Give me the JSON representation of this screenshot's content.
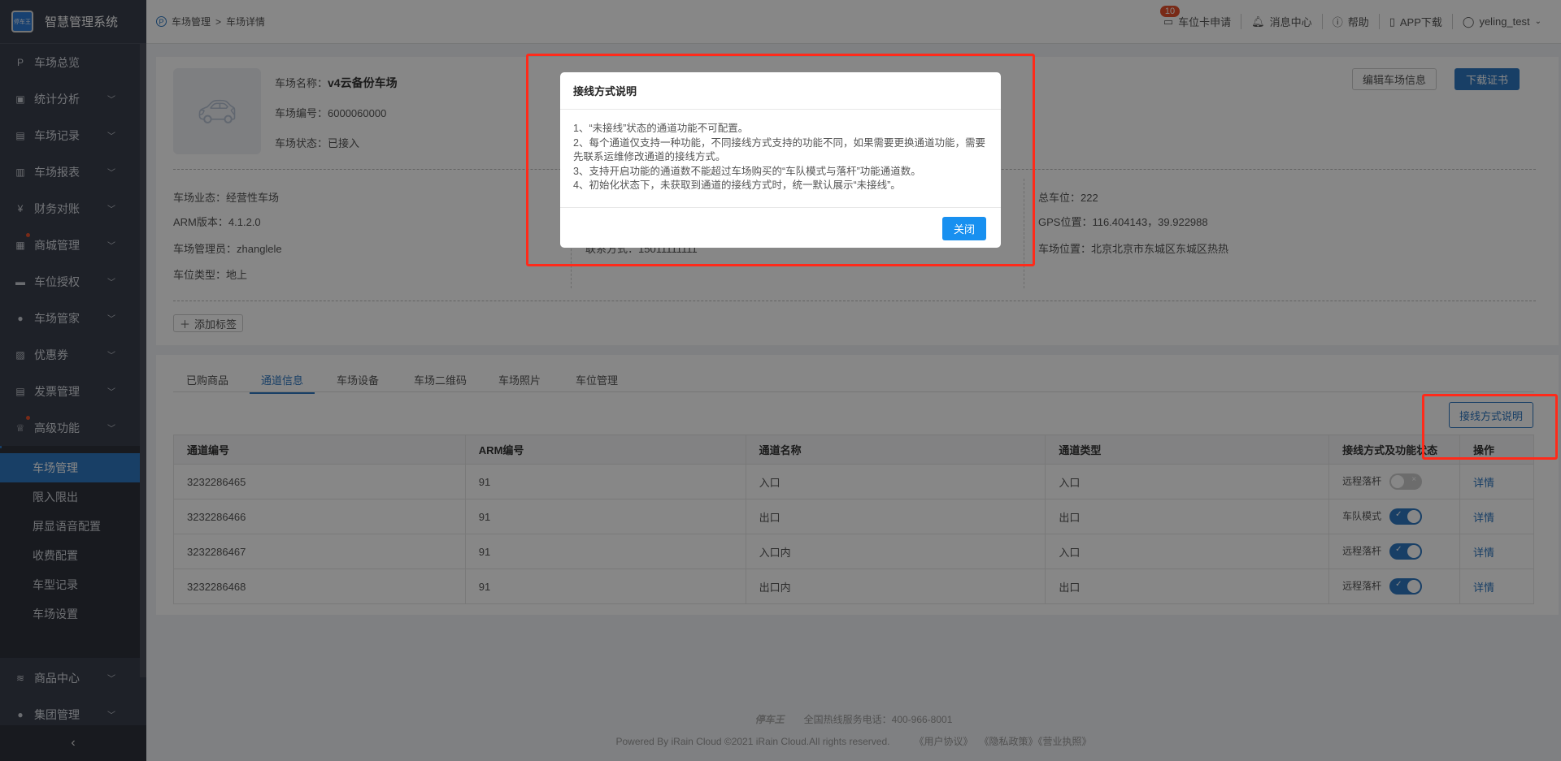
{
  "app": {
    "title": "智慧管理系统",
    "logo_text": "停车王"
  },
  "sidebar": {
    "items": [
      {
        "label": "车场总览",
        "icon": "parking-car-icon"
      },
      {
        "label": "统计分析",
        "icon": "monitor-icon"
      },
      {
        "label": "车场记录",
        "icon": "file-icon"
      },
      {
        "label": "车场报表",
        "icon": "report-icon"
      },
      {
        "label": "财务对账",
        "icon": "yen-icon"
      },
      {
        "label": "商城管理",
        "icon": "shop-icon"
      },
      {
        "label": "车位授权",
        "icon": "car-icon"
      },
      {
        "label": "车场管家",
        "icon": "user-icon"
      },
      {
        "label": "优惠券",
        "icon": "coupon-icon"
      },
      {
        "label": "发票管理",
        "icon": "invoice-icon"
      },
      {
        "label": "高级功能",
        "icon": "crown-icon"
      },
      {
        "label": "车场管理",
        "icon": "parking-icon"
      }
    ],
    "sub_items": [
      "车场管理",
      "限入限出",
      "屏显语音配置",
      "收费配置",
      "车型记录",
      "车场设置"
    ],
    "bottom_items": [
      {
        "label": "商品中心",
        "icon": "layers-icon"
      },
      {
        "label": "集团管理",
        "icon": "group-icon"
      }
    ],
    "collapse": "‹"
  },
  "header": {
    "breadcrumb": [
      "车场管理",
      "车场详情"
    ],
    "separator": ">",
    "right": {
      "card_apply": "车位卡申请",
      "badge": "10",
      "messages": "消息中心",
      "help": "帮助",
      "app": "APP下载",
      "user": "yeling_test"
    }
  },
  "park": {
    "name_label": "车场名称：",
    "name": "v4云备份车场",
    "code": "车场编号：6000060000",
    "status": "车场状态：已接入",
    "edit_btn": "编辑车场信息",
    "download_btn": "下载证书",
    "col1": [
      "车场业态：经营性车场",
      "ARM版本：4.1.2.0",
      "车场管理员：zhanglele",
      "车位类型：地上"
    ],
    "col2": [
      "联系方式：15011111111"
    ],
    "col3": [
      "总车位：222",
      "GPS位置：116.404143，39.922988",
      "车场位置：北京北京市东城区东城区热热"
    ],
    "add_tag": "添加标签"
  },
  "tabs": [
    "已购商品",
    "通道信息",
    "车场设备",
    "车场二维码",
    "车场照片",
    "车位管理"
  ],
  "active_tab": 1,
  "wiring_btn": "接线方式说明",
  "table": {
    "headers": [
      "通道编号",
      "ARM编号",
      "通道名称",
      "通道类型",
      "接线方式及功能状态",
      "操作"
    ],
    "rows": [
      {
        "id": "3232286465",
        "arm": "91",
        "name": "入口",
        "type": "入口",
        "mode": "远程落杆",
        "on": false,
        "action": "详情"
      },
      {
        "id": "3232286466",
        "arm": "91",
        "name": "出口",
        "type": "出口",
        "mode": "车队模式",
        "on": true,
        "action": "详情"
      },
      {
        "id": "3232286467",
        "arm": "91",
        "name": "入口内",
        "type": "入口",
        "mode": "远程落杆",
        "on": true,
        "action": "详情"
      },
      {
        "id": "3232286468",
        "arm": "91",
        "name": "出口内",
        "type": "出口",
        "mode": "远程落杆",
        "on": true,
        "action": "详情"
      }
    ]
  },
  "footer": {
    "brand": "停车王",
    "hotline": "全国热线服务电话：400-966-8001",
    "powered": "Powered By iRain Cloud ©2021 iRain Cloud.All rights reserved.",
    "links": [
      "《用户协议》",
      "《隐私政策》",
      "《营业执照》"
    ]
  },
  "modal": {
    "title": "接线方式说明",
    "lines": [
      "1、“未接线”状态的通道功能不可配置。",
      "2、每个通道仅支持一种功能，不同接线方式支持的功能不同，如果需要更换通道功能，需要先联系运维修改通道的接线方式。",
      "3、支持开启功能的通道数不能超过车场购买的“车队模式与落杆”功能通道数。",
      "4、初始化状态下，未获取到通道的接线方式时，统一默认展示“未接线”。"
    ],
    "close": "关闭"
  },
  "colors": {
    "accent": "#2f77c0",
    "modal_button": "#1890f0",
    "highlight": "#ff2a1a"
  }
}
